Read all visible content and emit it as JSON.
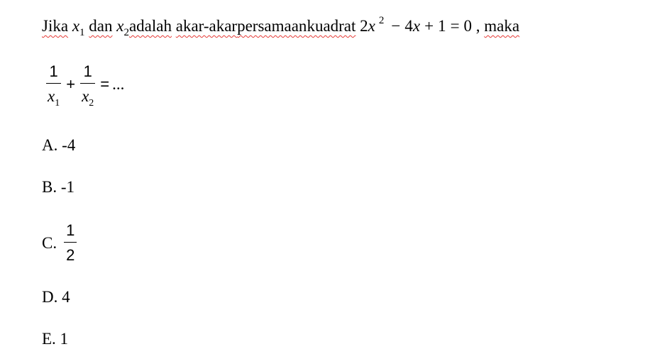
{
  "question": {
    "w_jika": "Jika",
    "x_var": "x",
    "sub_1": "1",
    "w_dan": "dan",
    "sub_2": "2",
    "w_adalah": "adalah",
    "w_akar": "akar-akar",
    "w_persamaan": "persamaan",
    "w_kuadrat": "kuadrat",
    "eq_coef": "2",
    "eq_pow": "2",
    "eq_minus": "−",
    "eq_term2": "4",
    "eq_plus": "+",
    "eq_const": "1",
    "eq_equals": "=",
    "eq_zero": "0",
    "w_comma": ",",
    "w_maka": "maka"
  },
  "expression": {
    "num1": "1",
    "num2": "1",
    "plus": "+",
    "equals": "=",
    "ellipsis": "..."
  },
  "options": {
    "a": "A. -4",
    "b": "B. -1",
    "c_label": "C.",
    "c_num": "1",
    "c_den": "2",
    "d": "D. 4",
    "e": "E. 1"
  },
  "colors": {
    "spellcheck_underline": "#e53935",
    "text": "#000000",
    "background": "#ffffff"
  }
}
